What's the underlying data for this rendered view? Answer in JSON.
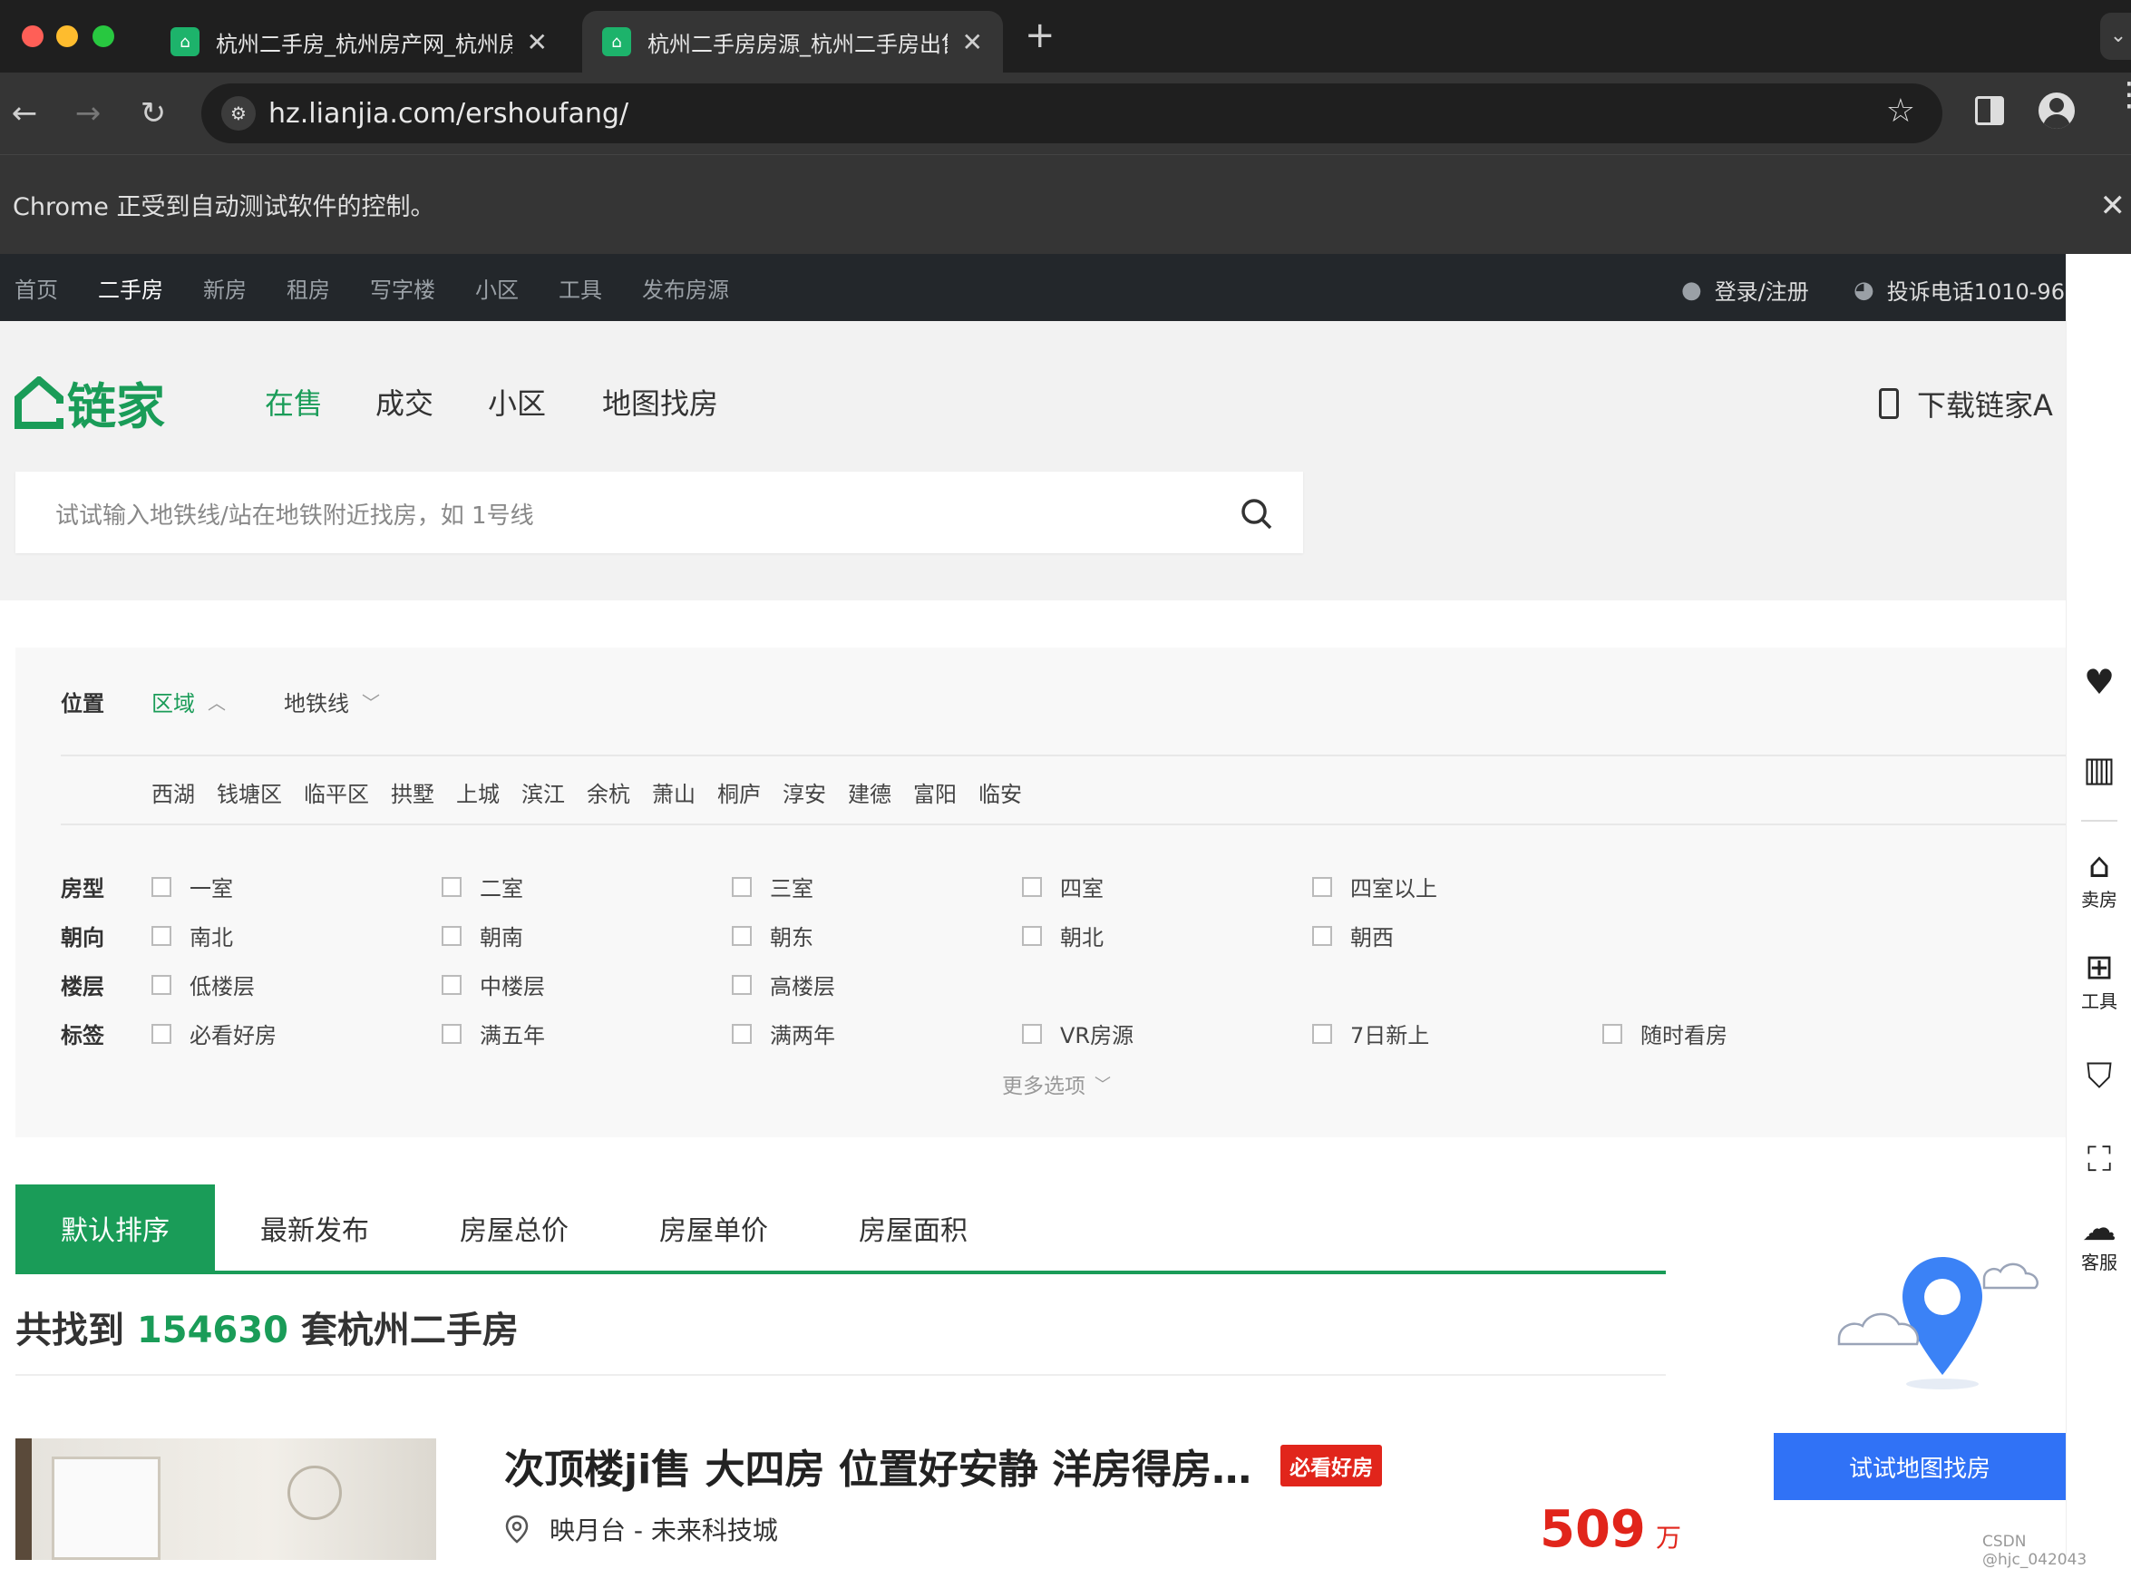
{
  "browser": {
    "tabs": [
      {
        "title": "杭州二手房_杭州房产网_杭州房",
        "active": false
      },
      {
        "title": "杭州二手房房源_杭州二手房出售",
        "active": true
      }
    ],
    "new_tab": "+",
    "url": "hz.lianjia.com/ershoufang/",
    "automation_notice": "Chrome 正受到自动测试软件的控制。"
  },
  "site_nav": {
    "items": [
      "首页",
      "二手房",
      "新房",
      "租房",
      "写字楼",
      "小区",
      "工具",
      "发布房源"
    ],
    "active_index": 1,
    "login": "登录/注册",
    "complaint": "投诉电话1010-96"
  },
  "header": {
    "logo_text": "链家",
    "main_nav": [
      "在售",
      "成交",
      "小区",
      "地图找房"
    ],
    "active_index": 0,
    "download": "下载链家A",
    "search_placeholder": "试试输入地铁线/站在地铁附近找房，如 1号线"
  },
  "filters": {
    "position_label": "位置",
    "position_tabs": [
      "区域",
      "地铁线"
    ],
    "districts": [
      "西湖",
      "钱塘区",
      "临平区",
      "拱墅",
      "上城",
      "滨江",
      "余杭",
      "萧山",
      "桐庐",
      "淳安",
      "建德",
      "富阳",
      "临安"
    ],
    "rows": [
      {
        "label": "房型",
        "options": [
          "一室",
          "二室",
          "三室",
          "四室",
          "四室以上"
        ]
      },
      {
        "label": "朝向",
        "options": [
          "南北",
          "朝南",
          "朝东",
          "朝北",
          "朝西"
        ]
      },
      {
        "label": "楼层",
        "options": [
          "低楼层",
          "中楼层",
          "高楼层"
        ]
      },
      {
        "label": "标签",
        "options": [
          "必看好房",
          "满五年",
          "满两年",
          "VR房源",
          "7日新上",
          "随时看房"
        ]
      }
    ],
    "more": "更多选项"
  },
  "sort_tabs": [
    "默认排序",
    "最新发布",
    "房屋总价",
    "房屋单价",
    "房屋面积"
  ],
  "result": {
    "prefix": "共找到",
    "count": "154630",
    "suffix": "套杭州二手房"
  },
  "listing": {
    "title": "次顶楼ji售 大四房 位置好安静 洋房得房…",
    "badge": "必看好房",
    "location": "映月台 - 未来科技城",
    "price": "509",
    "price_unit": "万"
  },
  "map_promo": {
    "button": "试试地图找房"
  },
  "right_bar": [
    {
      "icon": "heart-icon",
      "label": ""
    },
    {
      "icon": "compare-icon",
      "label": ""
    },
    {
      "icon": "sell-house-icon",
      "label": "卖房"
    },
    {
      "icon": "tools-icon",
      "label": "工具"
    },
    {
      "icon": "promise-icon",
      "label": ""
    },
    {
      "icon": "scan-icon",
      "label": ""
    },
    {
      "icon": "service-icon",
      "label": "客服"
    }
  ],
  "watermark": "CSDN @hjc_042043",
  "colors": {
    "brand_green": "#1a9c58",
    "price_red": "#e1251b",
    "badge_red": "#e1251b",
    "map_blue": "#3072f6"
  }
}
